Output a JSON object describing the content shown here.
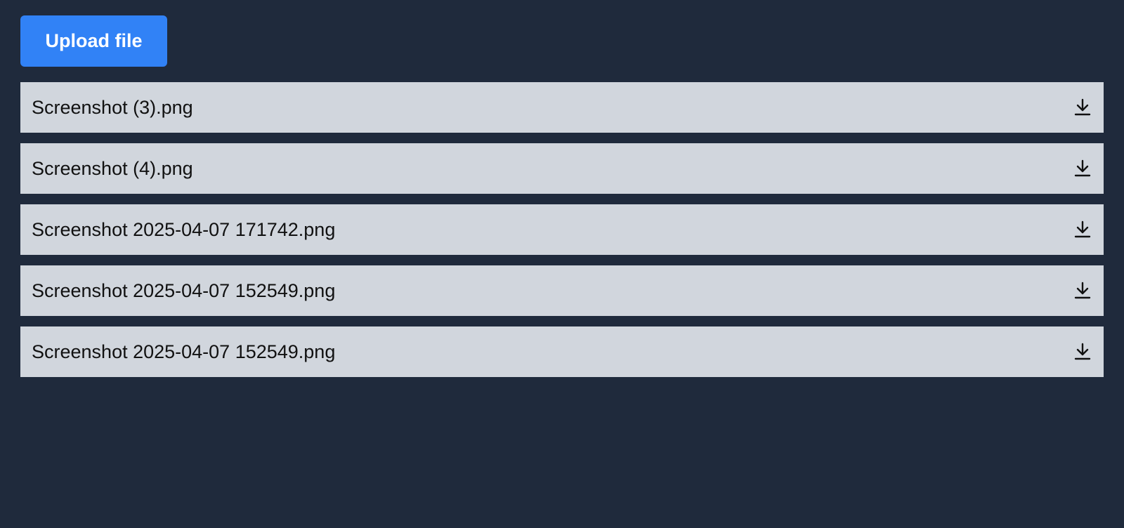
{
  "toolbar": {
    "upload_label": "Upload file"
  },
  "files": [
    {
      "name": "Screenshot (3).png",
      "action_icon": "download-icon"
    },
    {
      "name": "Screenshot (4).png",
      "action_icon": "download-icon"
    },
    {
      "name": "Screenshot 2025-04-07 171742.png",
      "action_icon": "download-icon"
    },
    {
      "name": "Screenshot 2025-04-07 152549.png",
      "action_icon": "download-icon"
    },
    {
      "name": "Screenshot 2025-04-07 152549.png",
      "action_icon": "download-icon"
    }
  ],
  "colors": {
    "background": "#1f2a3c",
    "accent": "#3182f6",
    "row": "#d1d6dd",
    "text": "#111111"
  }
}
